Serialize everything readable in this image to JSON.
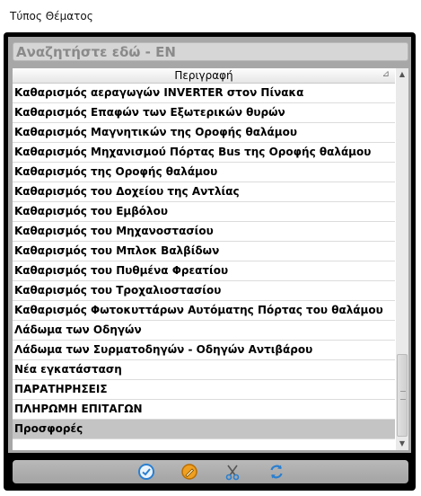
{
  "window": {
    "title": "Τύπος Θέματος"
  },
  "search": {
    "value": "Αναζητήστε εδώ - EN"
  },
  "grid": {
    "column_header": "Περιγραφή",
    "sort_glyph": "⊿",
    "selected_index": 17,
    "rows": [
      "Καθαρισμός αεραγωγών INVERTER στον Πίνακα",
      "Καθαρισμός Επαφών των Εξωτερικών θυρών",
      "Καθαρισμός Μαγνητικών της Οροφής θαλάμου",
      "Καθαρισμός Μηχανισμού Πόρτας Bus της Οροφής θαλάμου",
      "Καθαρισμός της Οροφής θαλάμου",
      "Καθαρισμός του Δοχείου της Αντλίας",
      "Καθαρισμός του Εμβόλου",
      "Καθαρισμός του Μηχανοστασίου",
      "Καθαρισμός του Μπλοκ Βαλβίδων",
      "Καθαρισμός του Πυθμένα Φρεατίου",
      "Καθαρισμός του Τροχαλιοστασίου",
      "Καθαρισμός Φωτοκυττάρων Αυτόματης Πόρτας του θαλάμου",
      "Λάδωμα των Οδηγών",
      "Λάδωμα των Συρματοδηγών - Οδηγών Αντιβάρου",
      "Νέα εγκατάσταση",
      "ΠΑΡΑΤΗΡΗΣΕΙΣ",
      "ΠΛΗΡΩΜΗ ΕΠΙΤΑΓΩΝ",
      "Προσφορές"
    ]
  },
  "toolbar": {
    "buttons": [
      "confirm-icon",
      "edit-icon",
      "cut-icon",
      "refresh-icon"
    ]
  },
  "colors": {
    "accent_blue": "#2a7fd0",
    "edit_orange": "#f0a020",
    "selected_row": "#c4c4c4"
  }
}
